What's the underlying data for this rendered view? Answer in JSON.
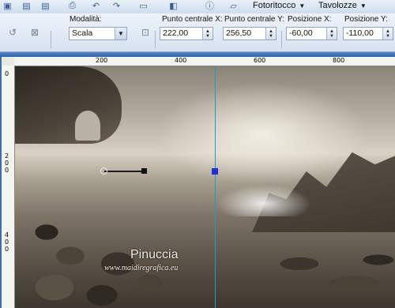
{
  "toolbar1": {
    "icons": [
      "folder-icon",
      "save-icon",
      "save-all-icon",
      "print-icon",
      "undo-icon",
      "redo-icon",
      "copy-icon",
      "image-icon",
      "info-icon",
      "eraser-icon"
    ],
    "menu_photo": "Fotoritocco",
    "menu_palettes": "Tavolozze"
  },
  "tool_options": {
    "mode_label": "Modalità:",
    "mode_value": "Scala",
    "center_x_label": "Punto centrale X:",
    "center_x_value": "222,00",
    "center_y_label": "Punto centrale Y:",
    "center_y_value": "256,50",
    "pos_x_label": "Posizione X:",
    "pos_x_value": "-60,00",
    "pos_y_label": "Posizione Y:",
    "pos_y_value": "-110,00"
  },
  "ruler": {
    "top_labels": [
      "200",
      "400",
      "600",
      "800"
    ],
    "left_labels": [
      "0",
      "2",
      "0",
      "0",
      "4",
      "0",
      "0"
    ]
  },
  "canvas": {
    "watermark_name": "Pinuccia",
    "watermark_url": "www.maidiregrafica.eu"
  }
}
